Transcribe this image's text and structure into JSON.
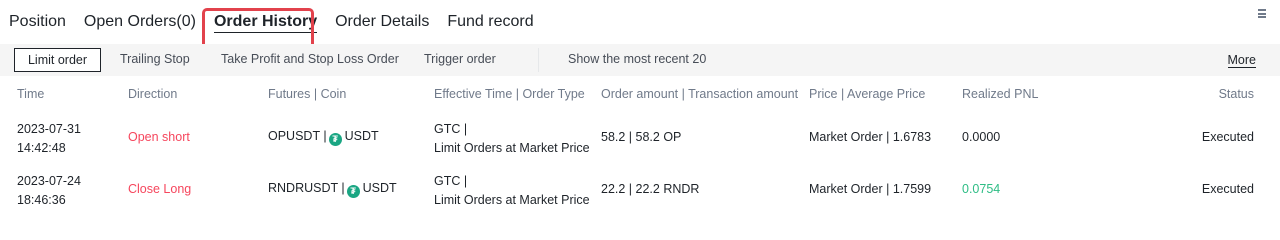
{
  "tabs": [
    {
      "label": "Position"
    },
    {
      "label": "Open Orders(0)"
    },
    {
      "label": "Order History"
    },
    {
      "label": "Order Details"
    },
    {
      "label": "Fund record"
    }
  ],
  "filters": {
    "types": [
      "Limit order",
      "Trailing Stop",
      "Take Profit and Stop Loss Order",
      "Trigger order"
    ],
    "recent": "Show the most recent 20",
    "more": "More"
  },
  "table": {
    "headers": [
      "Time",
      "Direction",
      "Futures | Coin",
      "Effective Time | Order Type",
      "Order amount | Transaction amount",
      "Price | Average Price",
      "Realized PNL",
      "Status"
    ],
    "rows": [
      {
        "date": "2023-07-31",
        "time": "14:42:48",
        "direction": "Open short",
        "futures": "OPUSDT |",
        "coin": "USDT",
        "effective": "GTC |",
        "order_type": "Limit Orders at Market Price",
        "amount": "58.2 | 58.2 OP",
        "price": "Market Order | 1.6783",
        "pnl": "0.0000",
        "status": "Executed"
      },
      {
        "date": "2023-07-24",
        "time": "18:46:36",
        "direction": "Close Long",
        "futures": "RNDRUSDT |",
        "coin": "USDT",
        "effective": "GTC |",
        "order_type": "Limit Orders at Market Price",
        "amount": "22.2 | 22.2 RNDR",
        "price": "Market Order | 1.7599",
        "pnl": "0.0754",
        "status": "Executed"
      }
    ]
  },
  "colors": {
    "highlight": "#e2424c",
    "negative": "#f6465d",
    "positive": "#2ebd85",
    "usdt_icon": "#1aa683"
  }
}
